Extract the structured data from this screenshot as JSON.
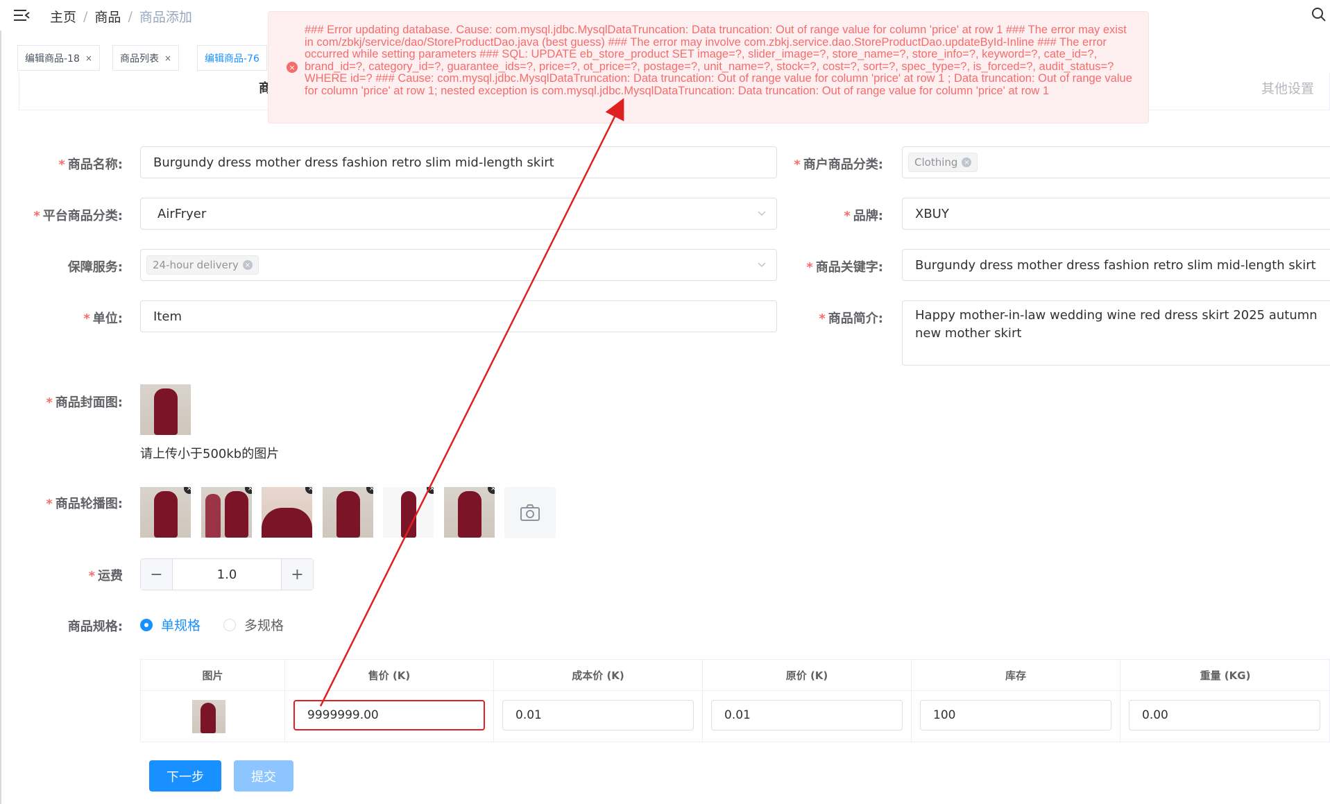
{
  "breadcrumb": {
    "home": "主页",
    "sep": "/",
    "section": "商品",
    "current": "商品添加"
  },
  "tabs": [
    {
      "label": "编辑商品-18",
      "close": "×"
    },
    {
      "label": "商品列表",
      "close": "×"
    },
    {
      "label": "编辑商品-76",
      "close": ""
    }
  ],
  "card": {
    "title_partial": "商",
    "other_settings": "其他设置"
  },
  "toast": {
    "type": "error",
    "message": "### Error updating database. Cause: com.mysql.jdbc.MysqlDataTruncation: Data truncation: Out of range value for column 'price' at row 1 ### The error may exist in com/zbkj/service/dao/StoreProductDao.java (best guess) ### The error may involve com.zbkj.service.dao.StoreProductDao.updateById-Inline ### The error occurred while setting parameters ### SQL: UPDATE eb_store_product SET image=?, slider_image=?, store_name=?, store_info=?, keyword=?, cate_id=?, brand_id=?, category_id=?, guarantee_ids=?, price=?, ot_price=?, postage=?, unit_name=?, stock=?, cost=?, sort=?, spec_type=?, is_forced=?, audit_status=? WHERE id=? ### Cause: com.mysql.jdbc.MysqlDataTruncation: Data truncation: Out of range value for column 'price' at row 1 ; Data truncation: Out of range value for column 'price' at row 1; nested exception is com.mysql.jdbc.MysqlDataTruncation: Data truncation: Out of range value for column 'price' at row 1"
  },
  "form": {
    "required_mark": "*",
    "name": {
      "label": "商品名称:",
      "value": "Burgundy dress mother dress fashion retro slim mid-length skirt"
    },
    "merchant_category": {
      "label": "商户商品分类:",
      "tag": "Clothing"
    },
    "platform_category": {
      "label": "平台商品分类:",
      "value": "AirFryer"
    },
    "brand": {
      "label": "品牌:",
      "value": "XBUY"
    },
    "guarantee": {
      "label": "保障服务:",
      "tag": "24-hour delivery"
    },
    "keywords": {
      "label": "商品关键字:",
      "value": "Burgundy dress mother dress fashion retro slim mid-length skirt"
    },
    "unit": {
      "label": "单位:",
      "value": "Item"
    },
    "intro": {
      "label": "商品简介:",
      "value": "Happy mother-in-law wedding wine red dress skirt 2025 autumn new mother skirt"
    },
    "cover": {
      "label": "商品封面图:",
      "hint": "请上传小于500kb的图片"
    },
    "carousel": {
      "label": "商品轮播图:",
      "count": 6
    },
    "shipping": {
      "label": "运费",
      "value": "1.0",
      "minus": "−",
      "plus": "+"
    },
    "spec": {
      "label": "商品规格:",
      "single": "单规格",
      "multi": "多规格",
      "selected": "single"
    }
  },
  "table": {
    "headers": [
      "图片",
      "售价 (K)",
      "成本价 (K)",
      "原价 (K)",
      "库存",
      "重量 (KG)"
    ],
    "row": {
      "price": "9999999.00",
      "cost": "0.01",
      "original": "0.01",
      "stock": "100",
      "weight": "0.00"
    }
  },
  "buttons": {
    "next": "下一步",
    "submit": "提交"
  },
  "colors": {
    "primary": "#1890ff",
    "error": "#f56c6c",
    "annotation": "#e02020"
  }
}
